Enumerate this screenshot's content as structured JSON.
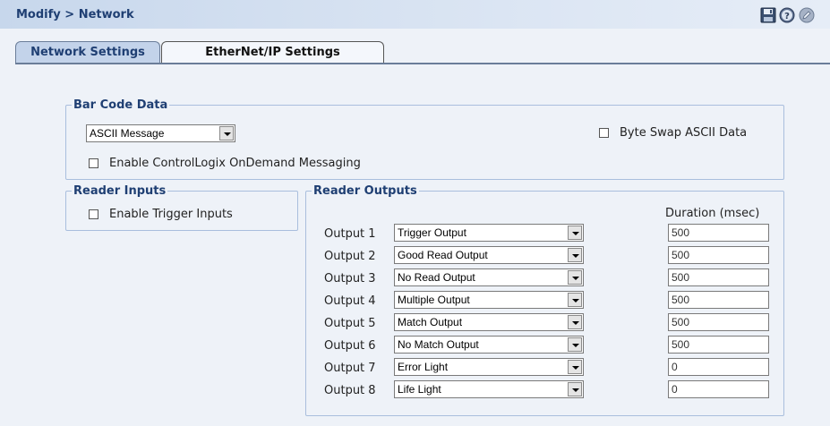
{
  "header": {
    "title": "Modify > Network",
    "icons": [
      "save-icon",
      "help-icon",
      "edit-icon"
    ]
  },
  "tabs": [
    {
      "label": "Network Settings",
      "active": false
    },
    {
      "label": "EtherNet/IP Settings",
      "active": true
    }
  ],
  "barcode": {
    "legend": "Bar Code Data",
    "format_selected": "ASCII Message",
    "byte_swap_label": "Byte Swap ASCII Data",
    "byte_swap_checked": false,
    "ondemand_label": "Enable ControlLogix OnDemand Messaging",
    "ondemand_checked": false
  },
  "inputs": {
    "legend": "Reader Inputs",
    "trigger_label": "Enable Trigger Inputs",
    "trigger_checked": false
  },
  "outputs": {
    "legend": "Reader Outputs",
    "duration_header": "Duration (msec)",
    "rows": [
      {
        "label": "Output 1",
        "function": "Trigger Output",
        "duration": "500"
      },
      {
        "label": "Output 2",
        "function": "Good Read Output",
        "duration": "500"
      },
      {
        "label": "Output 3",
        "function": "No Read Output",
        "duration": "500"
      },
      {
        "label": "Output 4",
        "function": "Multiple Output",
        "duration": "500"
      },
      {
        "label": "Output 5",
        "function": "Match Output",
        "duration": "500"
      },
      {
        "label": "Output 6",
        "function": "No Match Output",
        "duration": "500"
      },
      {
        "label": "Output 7",
        "function": "Error Light",
        "duration": "0"
      },
      {
        "label": "Output 8",
        "function": "Life Light",
        "duration": "0"
      }
    ]
  },
  "colors": {
    "header_bg": "#c7d7ec",
    "title_text": "#1f3f73",
    "group_border": "#a9bedd",
    "page_bg": "#eef2f8"
  }
}
